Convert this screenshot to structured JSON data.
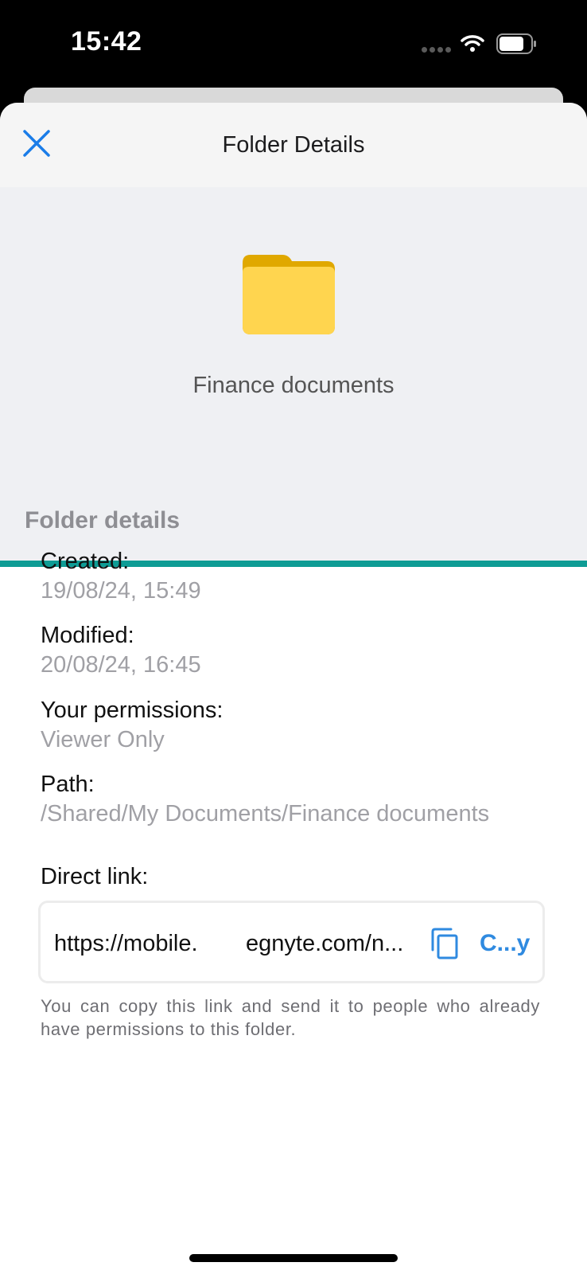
{
  "status_bar": {
    "time": "15:42",
    "icons": [
      "signal-dots-icon",
      "wifi-icon",
      "battery-icon"
    ]
  },
  "nav": {
    "title": "Folder Details",
    "close_icon": "close-icon"
  },
  "folder": {
    "name": "Finance documents",
    "icon": "folder-icon"
  },
  "details": {
    "section_title": "Folder details",
    "created_label": "Created:",
    "created_value": "19/08/24, 15:49",
    "modified_label": "Modified:",
    "modified_value": "20/08/24, 16:45",
    "permissions_label": "Your permissions:",
    "permissions_value": "Viewer Only",
    "path_label": "Path:",
    "path_value": "/Shared/My Documents/Finance documents"
  },
  "direct_link": {
    "label": "Direct link:",
    "url_part1": "https://mobile.",
    "url_part2": "egnyte.com/n...",
    "copy_label": "C...y",
    "helper_text": "You can copy this link and send it to people who already have permissions to this folder."
  },
  "colors": {
    "accent": "#0e9c95",
    "link_blue": "#2f8ae0",
    "folder_yellow": "#ffd54f",
    "folder_tab": "#e0a800"
  }
}
